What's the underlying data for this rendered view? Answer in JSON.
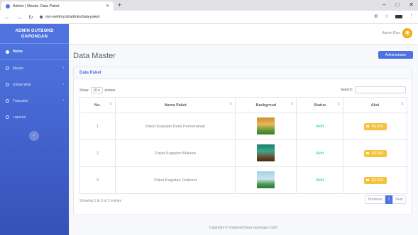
{
  "browser": {
    "tab_title": "Admin | Master Data Paket",
    "url": "riyo-seilimy.id/admin/data-paket"
  },
  "sidebar": {
    "brand_line1": "ADMIN OUTBOND",
    "brand_line2": "GARONGAN",
    "items": [
      {
        "label": "Home"
      },
      {
        "label": "Master"
      },
      {
        "label": "Kelola Web"
      },
      {
        "label": "Transaksi"
      },
      {
        "label": "Laporan"
      }
    ]
  },
  "topbar": {
    "user_name": "Admin Riyo"
  },
  "page": {
    "title": "Data Master",
    "admin_button": "Administrator"
  },
  "card": {
    "header": "Data Paket",
    "show_label": "Show",
    "entries_value": "10",
    "entries_label": "entries",
    "search_label": "Search:",
    "search_value": ""
  },
  "table": {
    "columns": [
      "No.",
      "Nama Paket",
      "Backgroud",
      "Status",
      "Aksi"
    ],
    "rows": [
      {
        "no": "1",
        "nama": "Paket Kegiatan Bumi Perkemahan",
        "status": "Aktif",
        "aksi": "DETAIL"
      },
      {
        "no": "2",
        "nama": "Paket Kegiatan Makrab",
        "status": "Aktif",
        "aksi": "DETAIL"
      },
      {
        "no": "3",
        "nama": "Paket Kegiatan Outbond",
        "status": "Aktif",
        "aksi": "DETAIL"
      }
    ]
  },
  "pagination": {
    "info": "Showing 1 to 3 of 3 entries",
    "previous": "Previous",
    "current": "1",
    "next": "Next"
  },
  "footer": {
    "copyright": "Copyright © Outbond Desa Garongan 2020"
  },
  "colors": {
    "primary": "#4e73df",
    "warning": "#f6c23e",
    "success": "#1cc88a"
  }
}
